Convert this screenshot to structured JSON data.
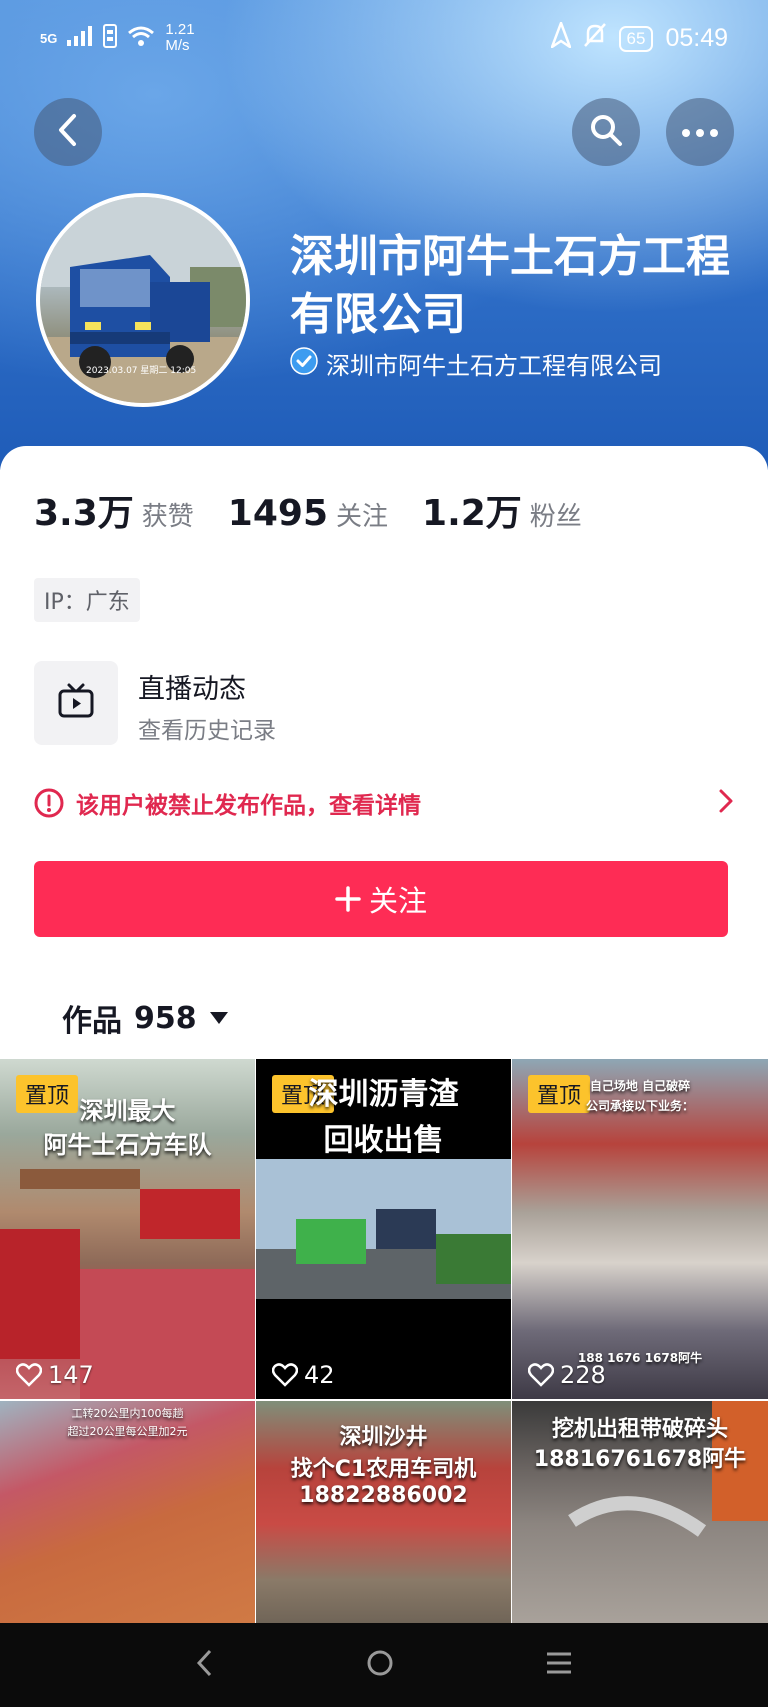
{
  "status_bar": {
    "network": "5G",
    "speed_value": "1.21",
    "speed_unit": "M/s",
    "battery": "65",
    "time": "05:49"
  },
  "header": {
    "back_icon": "chevron-left-icon",
    "search_icon": "search-icon",
    "more_icon": "more-dots-icon"
  },
  "profile": {
    "name": "深圳市阿牛土石方工程有限公司",
    "verified_label": "深圳市阿牛土石方工程有限公司",
    "avatar_caption": "2023.03.07 星期二 12:05"
  },
  "stats": [
    {
      "value": "3.3万",
      "label": "获赞"
    },
    {
      "value": "1495",
      "label": "关注"
    },
    {
      "value": "1.2万",
      "label": "粉丝"
    }
  ],
  "ip_label": "IP：广东",
  "live": {
    "title": "直播动态",
    "subtitle": "查看历史记录"
  },
  "ban_notice": "该用户被禁止发布作品，查看详情",
  "follow_button": "关注",
  "works": {
    "label": "作品",
    "count": "958"
  },
  "tiles": [
    {
      "pinned": true,
      "pin_label": "置顶",
      "likes": "147",
      "caption_1": "深圳最大",
      "caption_2": "阿牛土石方车队"
    },
    {
      "pinned": true,
      "pin_label": "置顶",
      "likes": "42",
      "caption_1": "深圳沥青渣",
      "caption_2": "回收出售"
    },
    {
      "pinned": true,
      "pin_label": "置顶",
      "likes": "228",
      "caption_1": "自己场地 自己破碎",
      "caption_2": "公司承接以下业务：",
      "caption_3": "188 1676 1678阿牛"
    },
    {
      "pinned": false,
      "caption_1": "工转20公里内100每趟",
      "caption_2": "超过20公里每公里加2元"
    },
    {
      "pinned": false,
      "caption_1": "深圳沙井",
      "caption_2": "找个C1农用车司机",
      "caption_3": "18822886002"
    },
    {
      "pinned": false,
      "caption_1": "挖机出租带破碎头",
      "caption_2": "18816761678阿牛"
    }
  ],
  "colors": {
    "accent": "#fe2c55",
    "ban_red": "#e0284f",
    "pin_yellow": "#fcc32c"
  }
}
